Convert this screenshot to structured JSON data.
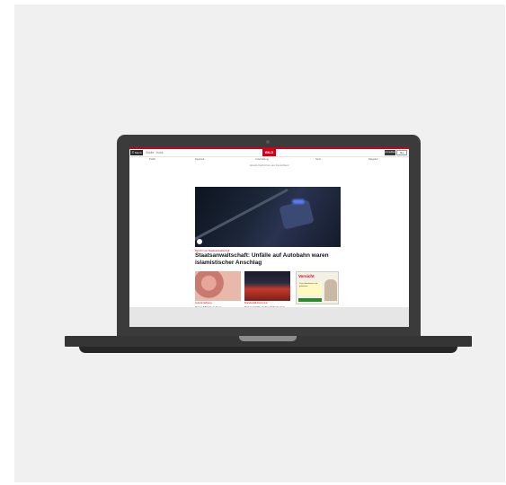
{
  "browser_page": {
    "header": {
      "menu_label": "☰ Menü",
      "nav_text": "Städte · Hubs",
      "logo_text": "BILD",
      "login_label": "Anmelden",
      "abo_label": "Abo"
    },
    "subnav": [
      "Politik",
      "Regional",
      "Unterhaltung",
      "Sport",
      "Ratgeber"
    ],
    "tagline": "Aktuelle Nachrichten aus Deutschland",
    "hero": {
      "kicker": "Bericht von Staatsanwaltschaft",
      "headline": "Staatsanwaltschaft: Unfälle auf Autobahn waren islamistischer Anschlag"
    },
    "teasers": [
      {
        "kicker": "Gute Ernährung",
        "title": "Darum Mittelmeer-Kost"
      },
      {
        "kicker": "Brandunfall-Dortmund",
        "title": "Rettungskräfte stellten Schaden fest"
      }
    ],
    "ad": {
      "title": "Vorsicht",
      "box_text": "Jetzt teilnehmen und gewinnen",
      "colors": {
        "accent": "#d0021b",
        "box": "#fff8c2"
      }
    }
  },
  "colors": {
    "brand": "#d0021b",
    "laptop_body": "#3b3b3b",
    "background_panel": "#f0f0f0"
  }
}
